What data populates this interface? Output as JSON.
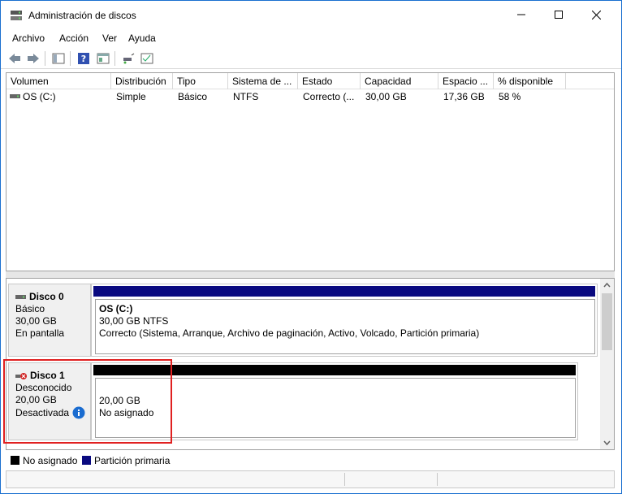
{
  "window": {
    "title": "Administración de discos",
    "minimize_icon": "minimize-icon",
    "maximize_icon": "maximize-icon",
    "close_icon": "close-icon"
  },
  "menu": {
    "items": [
      "Archivo",
      "Acción",
      "Ver",
      "Ayuda"
    ]
  },
  "toolbar": {
    "icons": [
      "back-icon",
      "forward-icon",
      "show-hide-tree-icon",
      "help-icon",
      "properties-icon",
      "connect-icon",
      "rescan-icon"
    ]
  },
  "volumes": {
    "columns": [
      "Volumen",
      "Distribución",
      "Tipo",
      "Sistema de ...",
      "Estado",
      "Capacidad",
      "Espacio ...",
      "% disponible"
    ],
    "rows": [
      {
        "volume": "OS (C:)",
        "layout": "Simple",
        "type": "Básico",
        "fs": "NTFS",
        "status": "Correcto (...",
        "capacity": "30,00 GB",
        "free": "17,36 GB",
        "pct": "58 %"
      }
    ]
  },
  "disks": [
    {
      "name": "Disco 0",
      "kind": "Básico",
      "size": "30,00 GB",
      "state": "En pantalla",
      "partition": {
        "label": "OS  (C:)",
        "size": "30,00 GB NTFS",
        "status": "Correcto (Sistema, Arranque, Archivo de paginación, Activo, Volcado, Partición primaria)"
      },
      "stripe_color": "#0a0a80"
    },
    {
      "name": "Disco 1",
      "kind": "Desconocido",
      "size": "20,00 GB",
      "state": "Desactivada",
      "partition": {
        "size": "20,00 GB",
        "status": "No asignado"
      },
      "stripe_color": "#000000"
    }
  ],
  "legend": [
    {
      "label": "No asignado",
      "color": "#000000"
    },
    {
      "label": "Partición primaria",
      "color": "#0a0a80"
    }
  ]
}
